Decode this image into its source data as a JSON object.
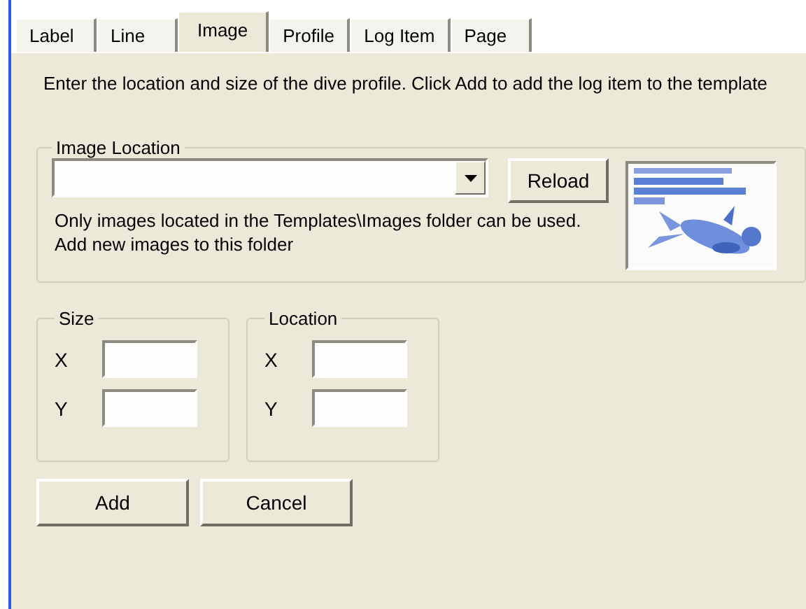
{
  "tabs": [
    {
      "label": "Label",
      "selected": false
    },
    {
      "label": "Line",
      "selected": false
    },
    {
      "label": "Image",
      "selected": true
    },
    {
      "label": "Profile",
      "selected": false
    },
    {
      "label": "Log Item",
      "selected": false
    },
    {
      "label": "Page",
      "selected": false
    }
  ],
  "description": "Enter the location and size of the dive profile.  Click Add to add the log item to the template",
  "image_location": {
    "title": "Image Location",
    "reload_button": "Reload",
    "help": "Only images located in the Templates\\Images folder can be used. Add new images to this folder"
  },
  "size": {
    "title": "Size",
    "fields": [
      {
        "label": "X"
      },
      {
        "label": "Y"
      }
    ]
  },
  "location": {
    "title": "Location",
    "fields": [
      {
        "label": "X"
      },
      {
        "label": "Y"
      }
    ]
  },
  "buttons": [
    "Add",
    "Cancel"
  ]
}
